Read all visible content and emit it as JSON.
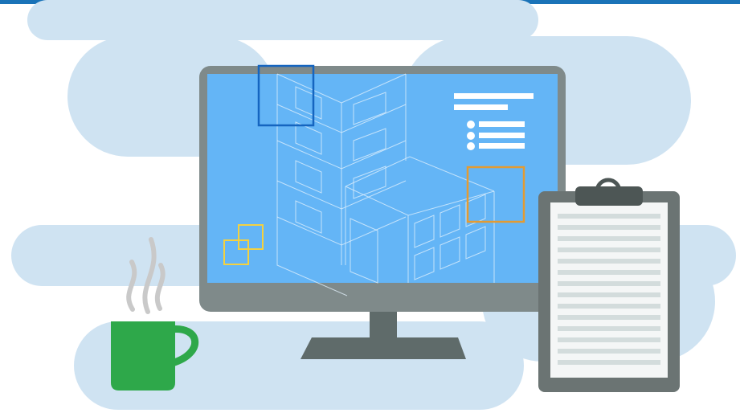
{
  "colors": {
    "top_bar": "#1a73b8",
    "cloud": "#cfe3f2",
    "screen": "#64b5f6",
    "bezel": "#7f8a8a",
    "stand": "#5f6b6a",
    "wireframe": "#e3f1fc",
    "accent_blue": "#1565c0",
    "accent_orange": "#e39b32",
    "accent_yellow": "#f4d13f",
    "text_lines": "#ffffff",
    "mug": "#2ea84a",
    "steam": "#c9c9c9",
    "clipboard_board": "#6b7473",
    "clipboard_paper": "#f4f6f6",
    "clipboard_lines": "#d3dcdc",
    "clipboard_clip": "#4d5655"
  },
  "icons": {
    "monitor": "desktop-monitor-icon",
    "mug": "coffee-mug-icon",
    "clipboard": "clipboard-icon",
    "building": "building-wireframe-icon"
  }
}
